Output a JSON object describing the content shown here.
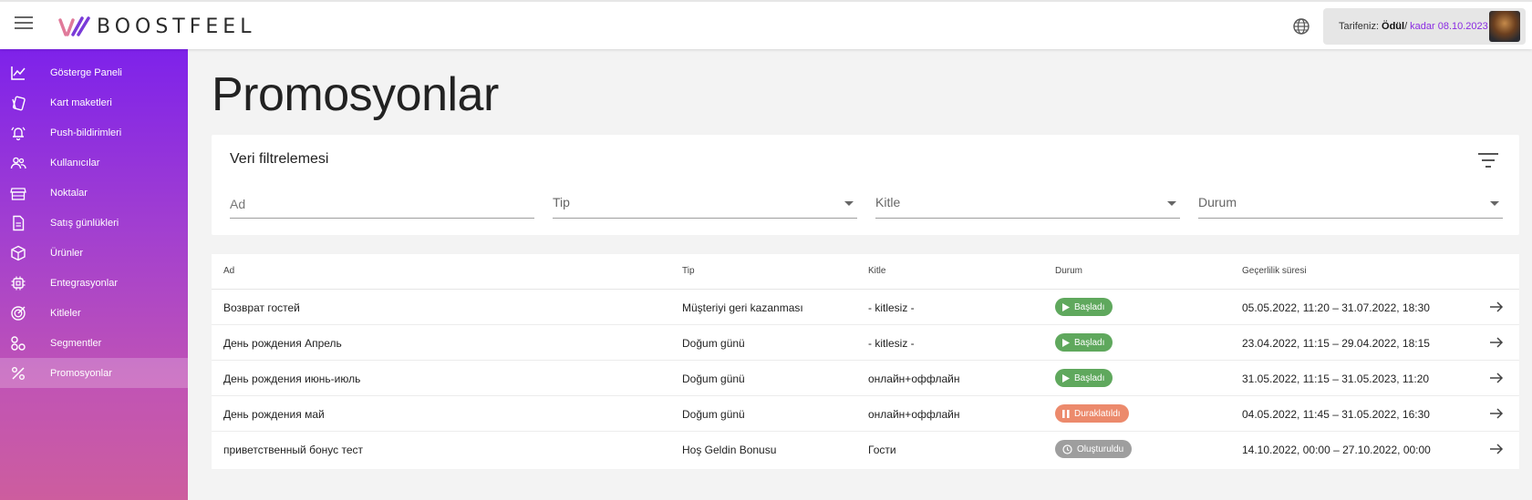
{
  "app": {
    "brand": "BOOSTFEEL",
    "tariff_label": "Tarifeniz:",
    "tariff_value": "Ödül",
    "tariff_sep": "/",
    "tariff_until": "kadar 08.10.2023"
  },
  "sidebar": {
    "items": [
      {
        "label": "Gösterge Paneli",
        "icon": "chart-line-icon"
      },
      {
        "label": "Kart maketleri",
        "icon": "cards-icon"
      },
      {
        "label": "Push-bildirimleri",
        "icon": "bell-icon"
      },
      {
        "label": "Kullanıcılar",
        "icon": "users-icon"
      },
      {
        "label": "Noktalar",
        "icon": "store-icon"
      },
      {
        "label": "Satış günlükleri",
        "icon": "document-icon"
      },
      {
        "label": "Ürünler",
        "icon": "box-icon"
      },
      {
        "label": "Entegrasyonlar",
        "icon": "chip-icon"
      },
      {
        "label": "Kitleler",
        "icon": "target-icon"
      },
      {
        "label": "Segmentler",
        "icon": "segments-icon"
      },
      {
        "label": "Promosyonlar",
        "icon": "percent-icon",
        "active": true
      }
    ]
  },
  "page": {
    "title": "Promosyonlar"
  },
  "filter": {
    "title": "Veri filtrelemesi",
    "name_placeholder": "Ad",
    "type_label": "Tip",
    "audience_label": "Kitle",
    "status_label": "Durum"
  },
  "table": {
    "headers": {
      "name": "Ad",
      "type": "Tip",
      "audience": "Kitle",
      "status": "Durum",
      "validity": "Geçerlilik süresi"
    },
    "rows": [
      {
        "name": "Возврат гостей",
        "type": "Müşteriyi geri kazanması",
        "audience": "- kitlesiz -",
        "status": "Başladı",
        "status_kind": "started",
        "validity": "05.05.2022, 11:20 – 31.07.2022, 18:30"
      },
      {
        "name": "День рождения Апрель",
        "type": "Doğum günü",
        "audience": "- kitlesiz -",
        "status": "Başladı",
        "status_kind": "started",
        "validity": "23.04.2022, 11:15 – 29.04.2022, 18:15"
      },
      {
        "name": "День рождения июнь-июль",
        "type": "Doğum günü",
        "audience": "онлайн+оффлайн",
        "status": "Başladı",
        "status_kind": "started",
        "validity": "31.05.2022, 11:15 – 31.05.2023, 11:20"
      },
      {
        "name": "День рождения май",
        "type": "Doğum günü",
        "audience": "онлайн+оффлайн",
        "status": "Duraklatıldı",
        "status_kind": "paused",
        "validity": "04.05.2022, 11:45 – 31.05.2022, 16:30"
      },
      {
        "name": "приветственный бонус тест",
        "type": "Hoş Geldin Bonusu",
        "audience": "Гости",
        "status": "Oluşturuldu",
        "status_kind": "created",
        "validity": "14.10.2022, 00:00 – 27.10.2022, 00:00"
      }
    ]
  },
  "colors": {
    "started": "#5fa85d",
    "paused": "#ec8a6c",
    "created": "#9e9e9e",
    "accent": "#8a2be2"
  }
}
